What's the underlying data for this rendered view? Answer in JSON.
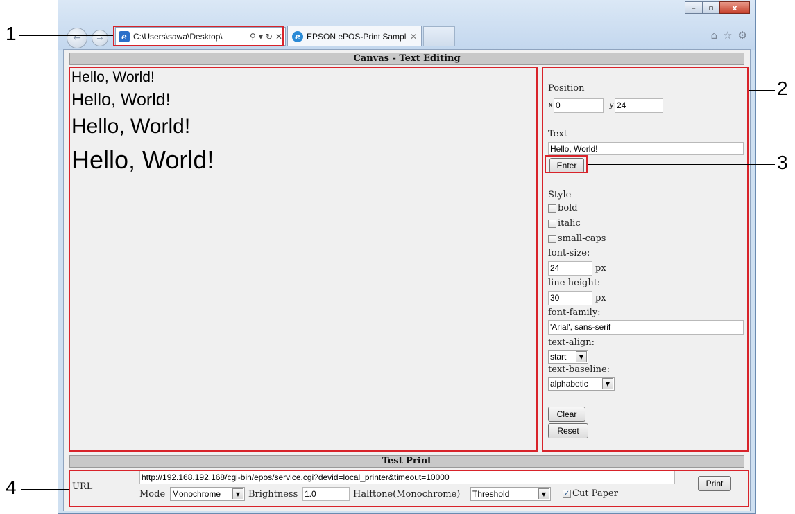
{
  "browser": {
    "address_text": "C:\\Users\\sawa\\Desktop\\",
    "tab_title": "EPSON ePOS-Print Sample ...",
    "search_glyph": "⚲",
    "dropdown_glyph": "▾",
    "refresh_glyph": "↻",
    "stop_glyph": "✕",
    "tab_close_glyph": "✕",
    "home_glyph": "⌂",
    "favorites_glyph": "☆",
    "tools_glyph": "⚙",
    "back_glyph": "←",
    "forward_glyph": "→",
    "ie_glyph": "e",
    "minimize_glyph": "–",
    "maximize_glyph": "▫",
    "close_glyph": "x"
  },
  "canvas_section": {
    "header": "Canvas - Text Editing",
    "preview_lines": [
      "Hello, World!",
      "Hello, World!",
      "Hello, World!",
      "Hello, World!"
    ]
  },
  "side_panel": {
    "position_label": "Position",
    "x_label": "x",
    "x_value": "0",
    "y_label": "y",
    "y_value": "24",
    "text_label": "Text",
    "text_value": "Hello, World!",
    "enter_button": "Enter",
    "style_label": "Style",
    "bold_label": "bold",
    "italic_label": "italic",
    "smallcaps_label": "small-caps",
    "font_size_label": "font-size:",
    "font_size_value": "24",
    "font_size_unit": "px",
    "line_height_label": "line-height:",
    "line_height_value": "30",
    "line_height_unit": "px",
    "font_family_label": "font-family:",
    "font_family_value": "'Arial', sans-serif",
    "text_align_label": "text-align:",
    "text_align_value": "start",
    "text_baseline_label": "text-baseline:",
    "text_baseline_value": "alphabetic",
    "clear_button": "Clear",
    "reset_button": "Reset"
  },
  "test_print": {
    "header": "Test Print",
    "url_label": "URL",
    "url_value": "http://192.168.192.168/cgi-bin/epos/service.cgi?devid=local_printer&timeout=10000",
    "mode_label": "Mode",
    "mode_value": "Monochrome",
    "brightness_label": "Brightness",
    "brightness_value": "1.0",
    "halftone_label": "Halftone(Monochrome)",
    "halftone_value": "Threshold",
    "cut_paper_label": "Cut Paper",
    "cut_paper_checked": true,
    "print_button": "Print"
  },
  "callouts": {
    "n1": "1",
    "n2": "2",
    "n3": "3",
    "n4": "4"
  },
  "colors": {
    "annotation_red": "#d8232a",
    "section_header_gray": "#c8c8c8",
    "panel_bg": "#f0f0f0"
  }
}
